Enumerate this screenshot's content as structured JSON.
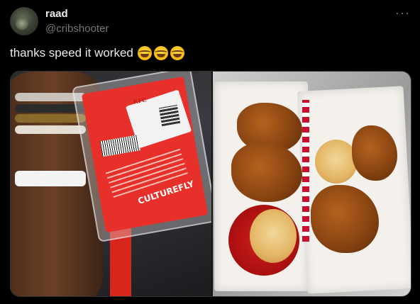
{
  "post": {
    "display_name": "raad",
    "handle": "@cribshooter",
    "more_label": "···",
    "text": "thanks speed it worked",
    "emojis": [
      "face-with-tears-of-joy",
      "face-with-tears-of-joy",
      "face-with-tears-of-joy"
    ]
  },
  "media": {
    "photos": [
      {
        "subject": "arm-with-red-kfc-tag",
        "tag_brand": "KFC",
        "tag_logo": "CULTUREFLY"
      },
      {
        "subject": "kfc-boxes-with-fried-chicken-and-biscuits"
      }
    ]
  },
  "colors": {
    "background": "#000000",
    "text_primary": "#e7e9ea",
    "text_secondary": "#71767b",
    "border": "#2f3336",
    "kfc_red": "#e8302a"
  }
}
